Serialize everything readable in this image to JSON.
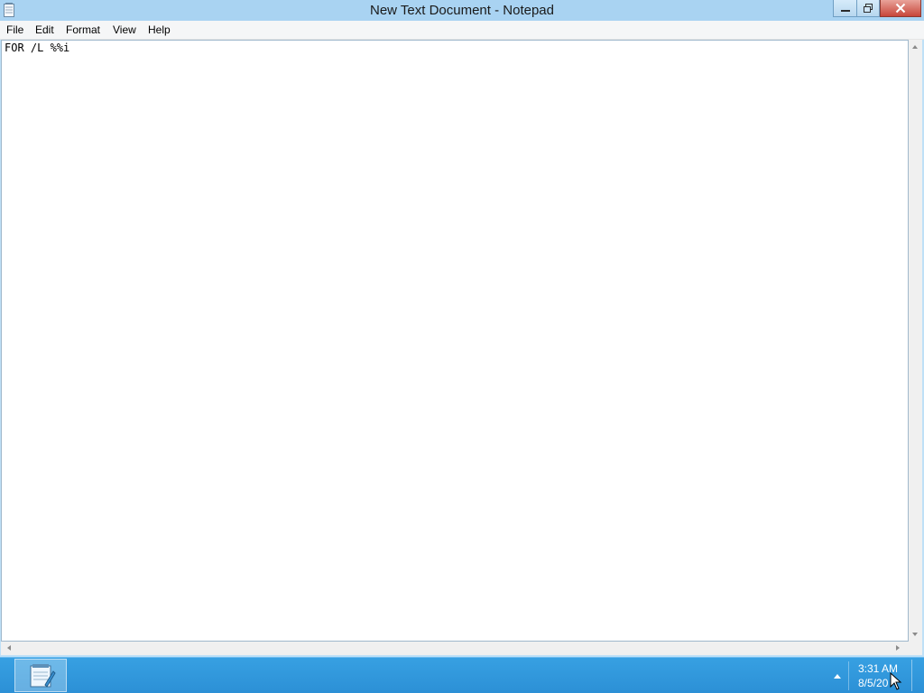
{
  "window": {
    "title": "New Text Document - Notepad",
    "app_icon": "notepad-icon"
  },
  "caption_buttons": {
    "minimize_icon": "minimize-icon",
    "maximize_icon": "restore-icon",
    "close_icon": "close-icon",
    "close_color": "#c7463a"
  },
  "menu": {
    "file": "File",
    "edit": "Edit",
    "format": "Format",
    "view": "View",
    "help": "Help"
  },
  "editor": {
    "content": "FOR /L %%i"
  },
  "taskbar": {
    "pinned_app_icon": "notepad-icon",
    "tray_icon": "show-hidden-icons-arrow",
    "time": "3:31 AM",
    "date": "8/5/20"
  },
  "colors": {
    "titlebar": "#a9d3f2",
    "taskbar": "#2c90d6"
  }
}
